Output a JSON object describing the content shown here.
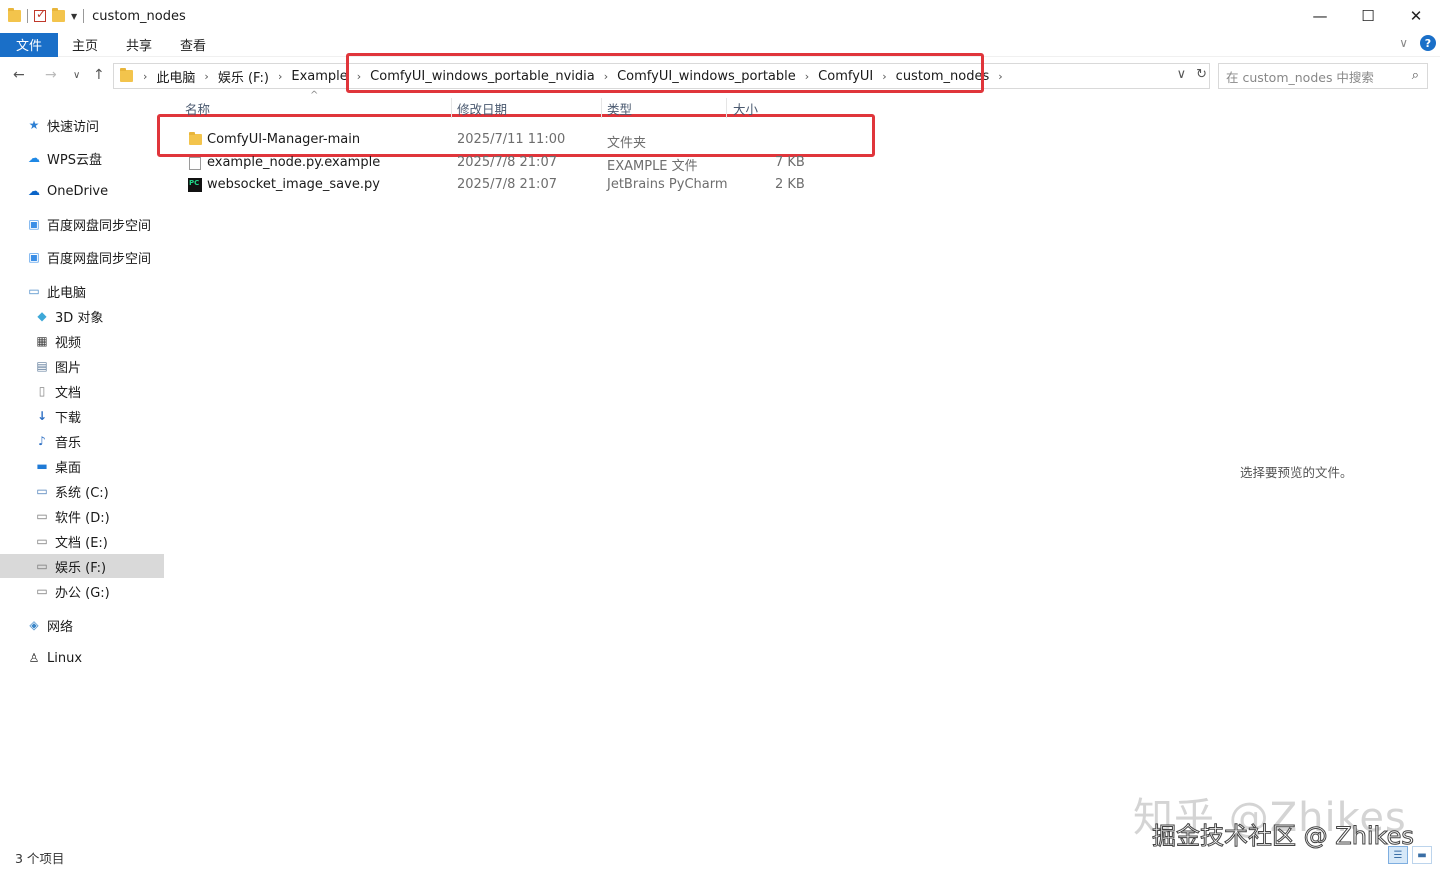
{
  "window": {
    "title": "custom_nodes",
    "controls": [
      "—",
      "☐",
      "✕"
    ]
  },
  "ribbon": {
    "tabs": [
      "文件",
      "主页",
      "共享",
      "查看"
    ],
    "help": "?"
  },
  "nav": {
    "back": "←",
    "forward": "→",
    "recent": "∨",
    "up": "↑"
  },
  "address": {
    "crumbs": [
      "此电脑",
      "娱乐 (F:)",
      "Example",
      "ComfyUI_windows_portable_nvidia",
      "ComfyUI_windows_portable",
      "ComfyUI",
      "custom_nodes"
    ],
    "separator": "›",
    "dropdown": "∨",
    "refresh": "↻"
  },
  "search": {
    "placeholder": "在 custom_nodes 中搜索"
  },
  "sidebar": {
    "items": [
      {
        "label": "快速访问",
        "icon": "star-icon",
        "glyph": "★"
      },
      {
        "label": "WPS云盘",
        "icon": "cloud-icon",
        "glyph": "☁"
      },
      {
        "label": "OneDrive",
        "icon": "onedrive-icon",
        "glyph": "☁"
      },
      {
        "label": "百度网盘同步空间",
        "icon": "baidu-sync-icon",
        "glyph": "▣"
      },
      {
        "label": "百度网盘同步空间",
        "icon": "baidu-sync-icon",
        "glyph": "▣"
      },
      {
        "label": "此电脑",
        "icon": "computer-icon",
        "glyph": "▭"
      },
      {
        "label": "3D 对象",
        "icon": "cube-icon",
        "glyph": "◆"
      },
      {
        "label": "视频",
        "icon": "film-icon",
        "glyph": "▦"
      },
      {
        "label": "图片",
        "icon": "picture-icon",
        "glyph": "▤"
      },
      {
        "label": "文档",
        "icon": "document-icon",
        "glyph": "▯"
      },
      {
        "label": "下载",
        "icon": "download-icon",
        "glyph": "↓"
      },
      {
        "label": "音乐",
        "icon": "music-icon",
        "glyph": "♪"
      },
      {
        "label": "桌面",
        "icon": "desktop-icon",
        "glyph": "▬"
      },
      {
        "label": "系统 (C:)",
        "icon": "system-drive-icon",
        "glyph": "▭"
      },
      {
        "label": "软件 (D:)",
        "icon": "drive-icon",
        "glyph": "▭"
      },
      {
        "label": "文档 (E:)",
        "icon": "drive-icon",
        "glyph": "▭"
      },
      {
        "label": "娱乐 (F:)",
        "icon": "drive-icon",
        "glyph": "▭"
      },
      {
        "label": "办公 (G:)",
        "icon": "drive-icon",
        "glyph": "▭"
      },
      {
        "label": "网络",
        "icon": "network-icon",
        "glyph": "◈"
      },
      {
        "label": "Linux",
        "icon": "linux-icon",
        "glyph": "♙"
      }
    ],
    "selected": "娱乐 (F:)"
  },
  "columns": {
    "name": "名称",
    "modified": "修改日期",
    "type": "类型",
    "size": "大小",
    "sort_caret": "^"
  },
  "files": [
    {
      "name": "ComfyUI-Manager-main",
      "modified": "2025/7/11 11:00",
      "type": "文件夹",
      "size": "",
      "icon": "folder-icon"
    },
    {
      "name": "example_node.py.example",
      "modified": "2025/7/8 21:07",
      "type": "EXAMPLE 文件",
      "size": "7 KB",
      "icon": "blank-file-icon"
    },
    {
      "name": "websocket_image_save.py",
      "modified": "2025/7/8 21:07",
      "type": "JetBrains PyCharm",
      "size": "2 KB",
      "icon": "pycharm-file-icon"
    }
  ],
  "preview": {
    "message": "选择要预览的文件。"
  },
  "status": {
    "count": "3 个项目"
  },
  "watermarks": {
    "primary": "知乎 @Zhikes",
    "secondary": "掘金技术社区 @ Zhikes"
  },
  "colors": {
    "accent": "#1a6fc8",
    "highlight_box": "#e0353b",
    "selected_bg": "#d9d9d9"
  }
}
